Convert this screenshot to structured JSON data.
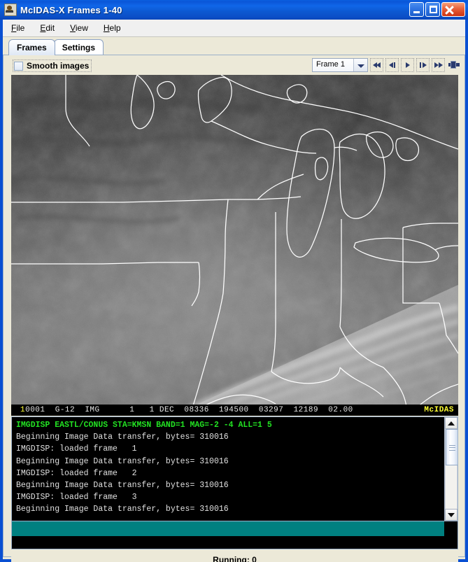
{
  "window": {
    "title": "McIDAS-X Frames 1-40",
    "icon": "java-coffee-icon",
    "buttons": {
      "minimize": "minimize-icon",
      "maximize": "maximize-icon",
      "close": "close-icon"
    }
  },
  "menubar": {
    "items": [
      {
        "label": "File",
        "mnemonic": "F"
      },
      {
        "label": "Edit",
        "mnemonic": "E"
      },
      {
        "label": "View",
        "mnemonic": "V"
      },
      {
        "label": "Help",
        "mnemonic": "H"
      }
    ]
  },
  "tabs": [
    {
      "label": "Frames",
      "selected": true
    },
    {
      "label": "Settings",
      "selected": false
    }
  ],
  "toolbar": {
    "smooth_images_label": "Smooth images",
    "smooth_images_checked": false,
    "frame_selector_value": "Frame 1",
    "frame_selector_options": [
      "Frame 1"
    ],
    "nav_buttons": [
      {
        "name": "first-frame-button",
        "icon": "skip-backward-icon"
      },
      {
        "name": "previous-frame-button",
        "icon": "step-backward-icon"
      },
      {
        "name": "play-button",
        "icon": "play-icon"
      },
      {
        "name": "next-frame-button",
        "icon": "step-forward-icon"
      },
      {
        "name": "last-frame-button",
        "icon": "skip-forward-icon"
      },
      {
        "name": "loop-toggle-button",
        "icon": "loop-icon"
      }
    ]
  },
  "image_status": {
    "frame_number": "1",
    "text": "0001  G-12  IMG      1   1 DEC  08336  194500  03297  12189  02.00",
    "brand": "McIDAS",
    "fields": {
      "dataset_id": "0001",
      "satellite": "G-12",
      "type": "IMG",
      "band": "1",
      "day_of_month": "1",
      "month": "DEC",
      "julian_date": "08336",
      "time": "194500",
      "line": "03297",
      "element": "12189",
      "resolution": "02.00"
    }
  },
  "console": {
    "lines": [
      {
        "text": "IMGDISP EASTL/CONUS STA=KMSN BAND=1 MAG=-2 -4 ALL=1 5",
        "type": "command"
      },
      {
        "text": "Beginning Image Data transfer, bytes= 310016",
        "type": "output"
      },
      {
        "text": "IMGDISP: loaded frame   1",
        "type": "output"
      },
      {
        "text": "Beginning Image Data transfer, bytes= 310016",
        "type": "output"
      },
      {
        "text": "IMGDISP: loaded frame   2",
        "type": "output"
      },
      {
        "text": "Beginning Image Data transfer, bytes= 310016",
        "type": "output"
      },
      {
        "text": "IMGDISP: loaded frame   3",
        "type": "output"
      },
      {
        "text": "Beginning Image Data transfer, bytes= 310016",
        "type": "output"
      }
    ],
    "scrollbar": {
      "up_arrow": "scroll-up-icon",
      "down_arrow": "scroll-down-icon"
    }
  },
  "status": {
    "running_label": "Running: 0"
  },
  "colors": {
    "titlebar_blue": "#0a56d8",
    "window_border": "#0a50d2",
    "panel_bg": "#ece9d8",
    "console_bg": "#000000",
    "console_text": "#e0e0e0",
    "console_command": "#22e022",
    "teal_bar": "#008080",
    "status_yellow": "#ffff33",
    "map_outline": "#ffffff"
  }
}
